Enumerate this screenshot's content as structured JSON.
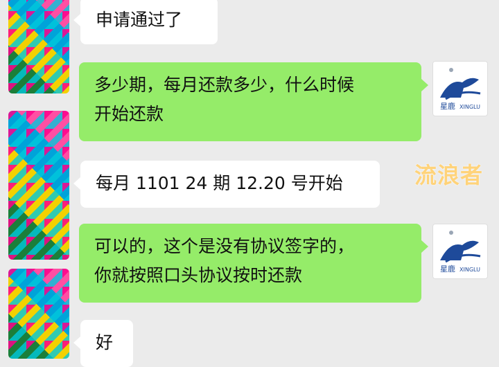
{
  "messages": [
    {
      "side": "left",
      "text": "申请通过了"
    },
    {
      "side": "right",
      "text_lines": [
        "多少期，每月还款多少，什么时候",
        "开始还款"
      ]
    },
    {
      "side": "left",
      "text": "每月 1101 24 期 12.20 号开始"
    },
    {
      "side": "right",
      "text_lines": [
        "可以的，这个是没有协议签字的，",
        "你就按照口头协议按时还款"
      ]
    },
    {
      "side": "left",
      "text": "好"
    }
  ],
  "logo": {
    "cn": "星鹿",
    "en": "XINGLU"
  },
  "watermark": "流浪者",
  "colors": {
    "background": "#ebebeb",
    "left_bubble": "#ffffff",
    "right_bubble": "#95ec69",
    "logo_blue": "#1e4a9a"
  }
}
